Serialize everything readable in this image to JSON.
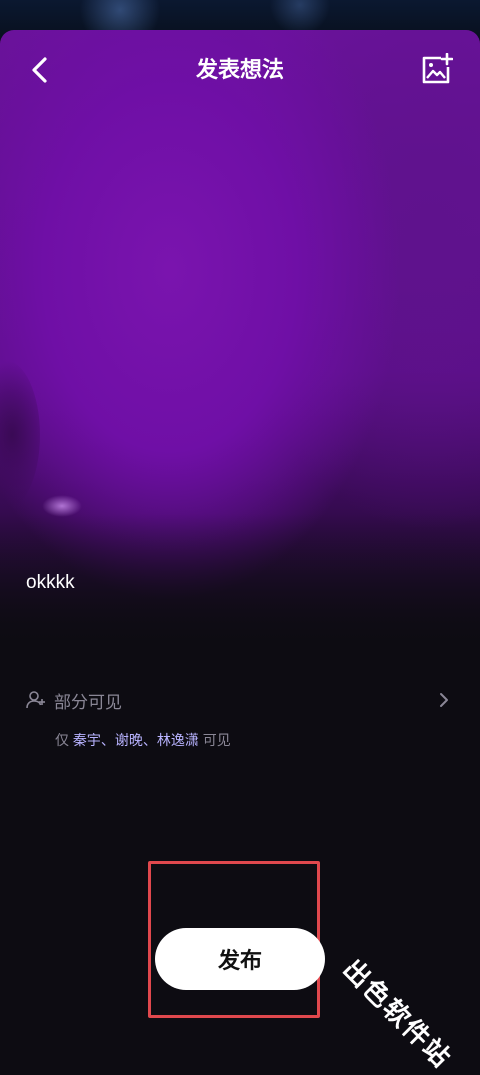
{
  "header": {
    "title": "发表想法"
  },
  "post": {
    "text": "okkkk"
  },
  "visibility": {
    "label": "部分可见",
    "prefix": "仅",
    "names": "秦宇、谢晚、林逸潇",
    "suffix": "可见"
  },
  "actions": {
    "publish_label": "发布"
  },
  "watermark": {
    "text": "出色软件站"
  },
  "icons": {
    "back": "back-arrow-icon",
    "image_add": "add-image-icon",
    "visibility": "person-add-icon",
    "chevron": "chevron-right-icon"
  },
  "colors": {
    "accent_purple": "#6f0fa6",
    "names_highlight": "#b8b3ff",
    "highlight_box": "#e0484d"
  }
}
